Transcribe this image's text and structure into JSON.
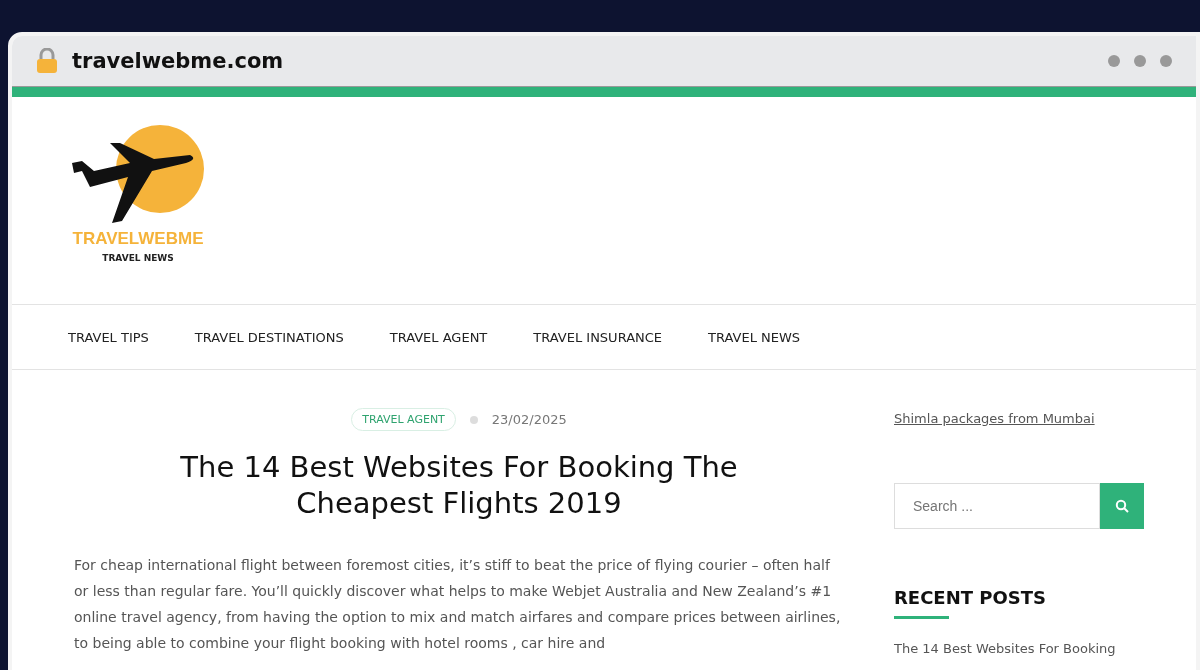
{
  "browser": {
    "url": "travelwebme.com"
  },
  "logo": {
    "name": "TRAVELWEBME",
    "tagline": "TRAVEL NEWS"
  },
  "nav": [
    {
      "label": "TRAVEL TIPS"
    },
    {
      "label": "TRAVEL DESTINATIONS"
    },
    {
      "label": "TRAVEL AGENT"
    },
    {
      "label": "TRAVEL INSURANCE"
    },
    {
      "label": "TRAVEL NEWS"
    }
  ],
  "article": {
    "category": "TRAVEL AGENT",
    "date": "23/02/2025",
    "title": "The 14 Best Websites For Booking The Cheapest Flights 2019",
    "body": "For cheap international flight between foremost cities, it’s stiff to beat the price of flying courier – often half or less than regular fare. You’ll quickly discover what helps to make Webjet Australia and New Zealand’s #1 online travel agency, from having the option to mix and match airfares and compare prices between airlines, to being able to combine your flight booking with hotel rooms , car hire and"
  },
  "sidebar": {
    "link": "Shimla packages from Mumbai",
    "search": {
      "placeholder": "Search ..."
    },
    "recent_title": "RECENT POSTS",
    "recent_posts": [
      "The 14 Best Websites For Booking"
    ]
  }
}
